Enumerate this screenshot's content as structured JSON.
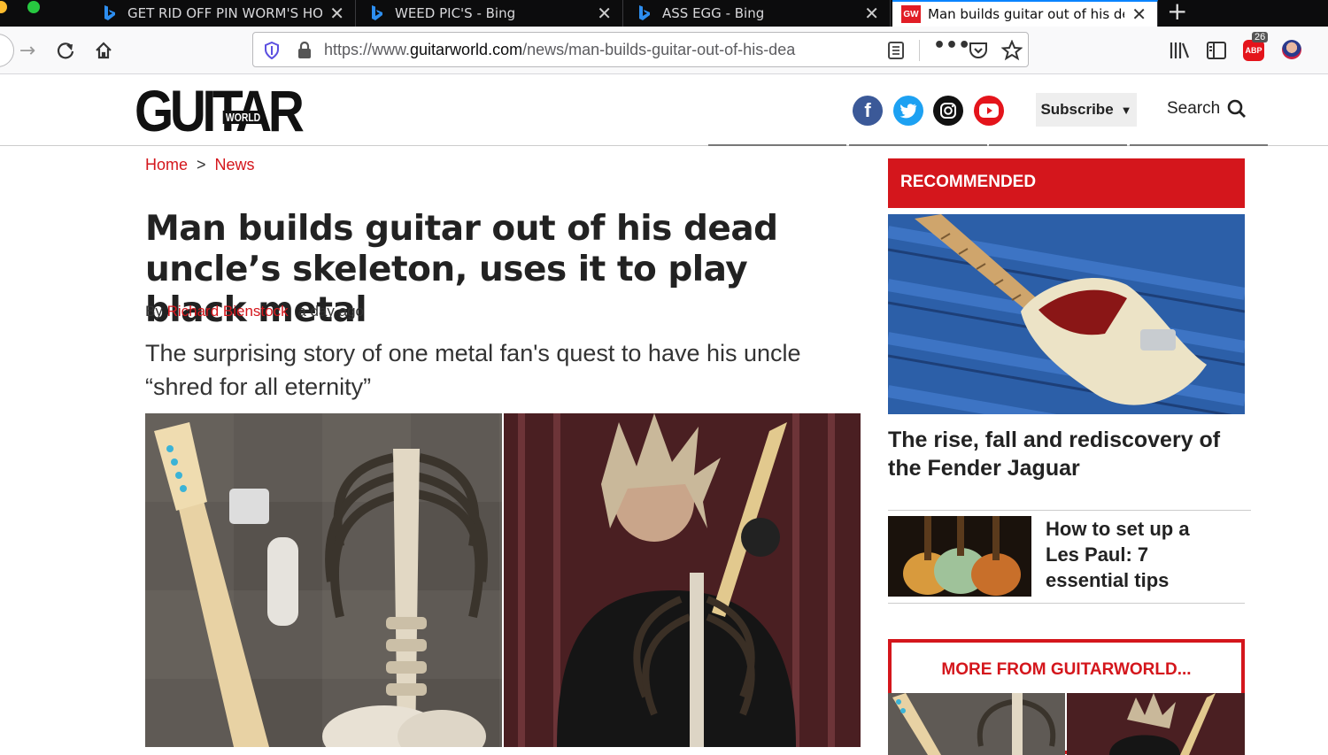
{
  "browser": {
    "tabs": [
      {
        "title": "GET RID OFF PIN WORM'S HOW TO",
        "active": false
      },
      {
        "title": "WEED PIC'S - Bing",
        "active": false
      },
      {
        "title": "ASS EGG - Bing",
        "active": false
      },
      {
        "title": "Man builds guitar out of his dead uncle",
        "active": true
      }
    ],
    "favicon_text": "GW",
    "url_prefix": "https://www.",
    "url_domain": "guitarworld.com",
    "url_path": "/news/man-builds-guitar-out-of-his-dea",
    "adblock_count": "26",
    "adblock_label": "ABP"
  },
  "site": {
    "logo_text": "GUITAR",
    "logo_sub": "WORLD",
    "subscribe_label": "Subscribe",
    "search_label": "Search",
    "social_icons": [
      "facebook-icon",
      "twitter-icon",
      "instagram-icon",
      "youtube-icon"
    ]
  },
  "breadcrumb": {
    "home": "Home",
    "separator": ">",
    "section": "News"
  },
  "article": {
    "title": "Man builds guitar out of his dead uncle’s skeleton, uses it to play black metal",
    "by_prefix": "By",
    "author": "Richard Bienstock",
    "time": "a day ago",
    "strapline": "The surprising story of one metal fan's quest to have his uncle “shred for all eternity”"
  },
  "sidebar": {
    "recommended_label": "RECOMMENDED",
    "items": [
      {
        "title": "The rise, fall and rediscovery of the Fender Jaguar"
      },
      {
        "title": "How to set up a Les Paul: 7 essential tips"
      }
    ],
    "more_label": "MORE FROM GUITARWORLD..."
  },
  "colors": {
    "brand_red": "#d4161c",
    "tab_bar": "#0c0c0d",
    "active_tab_accent": "#0a84ff"
  }
}
